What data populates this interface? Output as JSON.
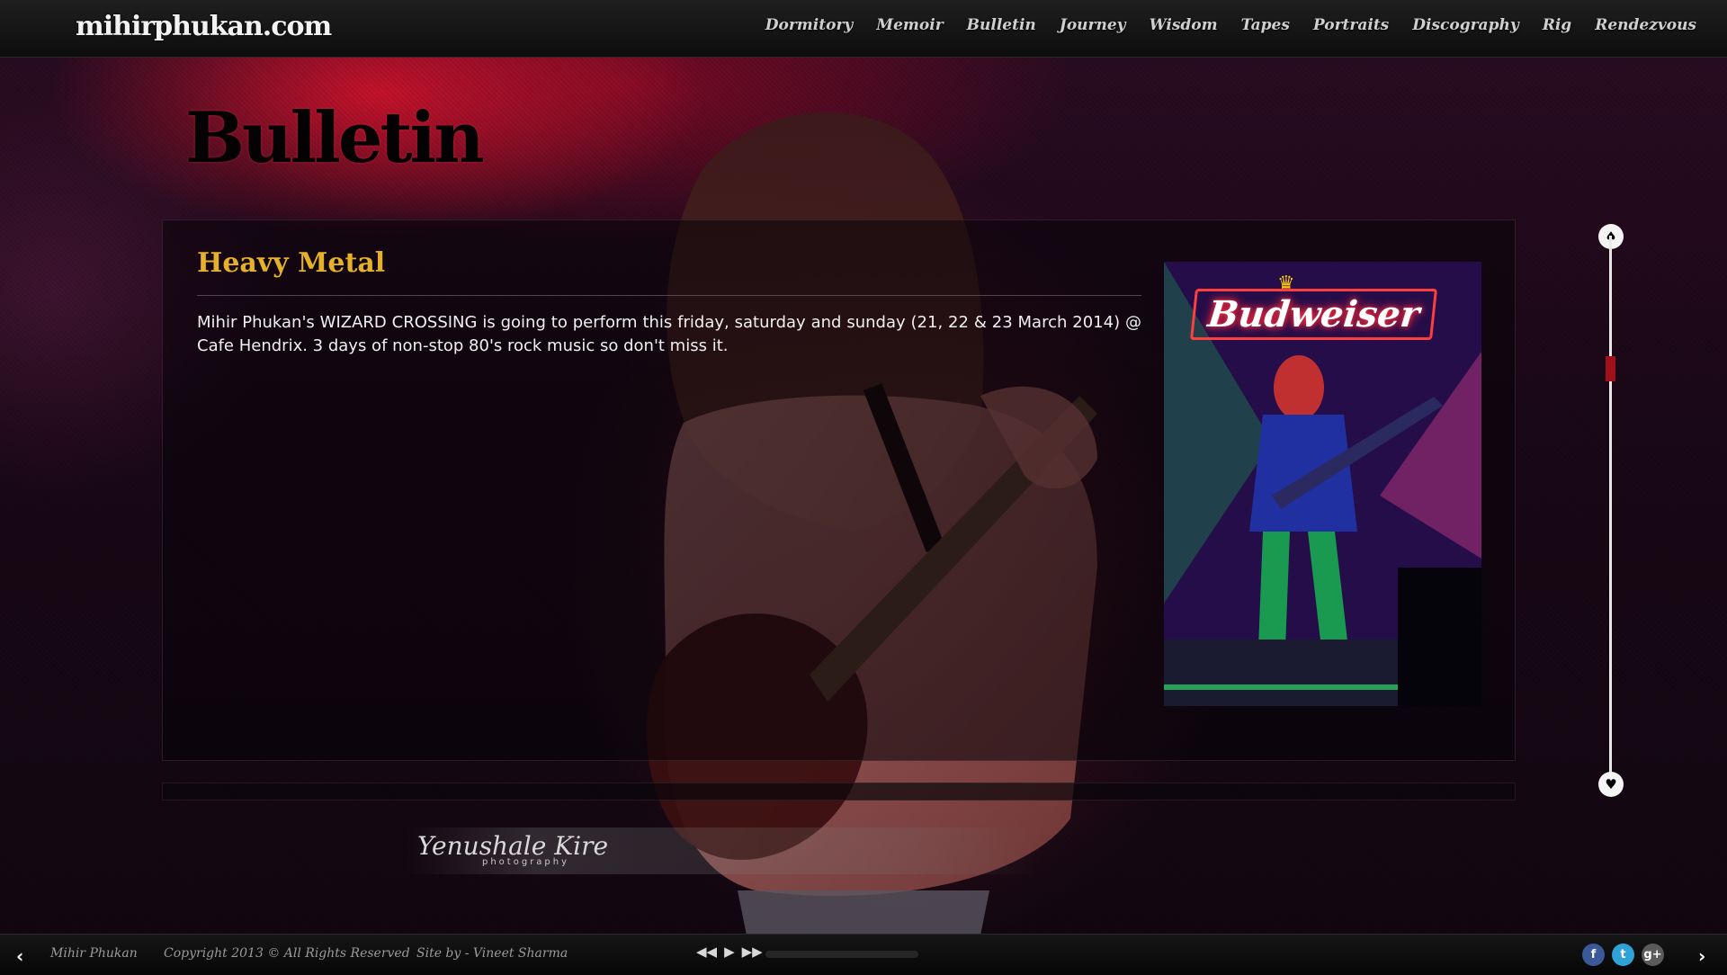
{
  "header": {
    "site_title": "mihirphukan.com",
    "nav": [
      "Dormitory",
      "Memoir",
      "Bulletin",
      "Journey",
      "Wisdom",
      "Tapes",
      "Portraits",
      "Discography",
      "Rig",
      "Rendezvous"
    ]
  },
  "page": {
    "heading": "Bulletin"
  },
  "post": {
    "title": "Heavy Metal",
    "body": "Mihir Phukan's WIZARD CROSSING is going to perform this friday, saturday and sunday (21, 22 & 23 March 2014) @ Cafe Hendrix. 3 days of non-stop 80's rock music so don't miss it.",
    "image_sign": "Budweiser"
  },
  "watermark": {
    "signature": "Yenushale Kire",
    "subtitle": "photography"
  },
  "scroll": {
    "position": 0.23
  },
  "footer": {
    "name": "Mihir Phukan",
    "copyright": "Copyright 2013 © All Rights Reserved",
    "credit": "Site by - Vineet Sharma",
    "player_progress": 0.0,
    "social": [
      "facebook-icon",
      "twitter-icon",
      "google-plus-icon"
    ]
  },
  "colors": {
    "accent": "#e5b02a",
    "scroll_thumb": "#a01018"
  }
}
